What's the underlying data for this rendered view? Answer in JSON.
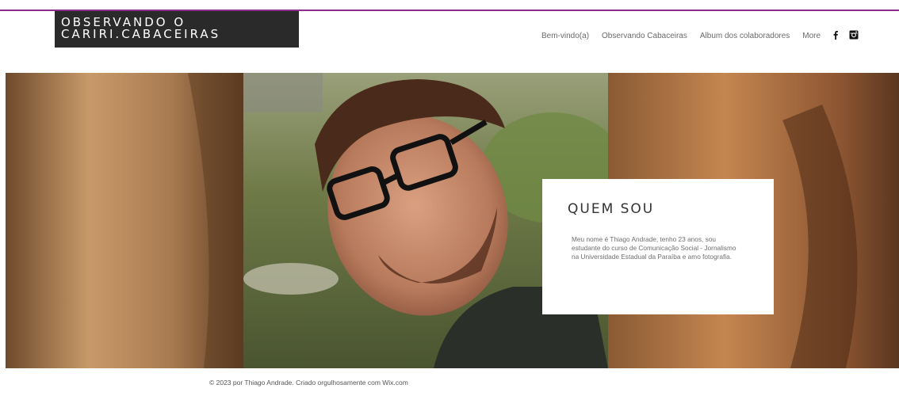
{
  "logo": {
    "line1": "OBSERVANDO O",
    "line2": "CARIRI.CABACEIRAS"
  },
  "nav": {
    "items": [
      {
        "label": "Bem-vindo(a)"
      },
      {
        "label": "Observando Cabaceiras"
      },
      {
        "label": "Album dos colaboradores"
      },
      {
        "label": "More"
      }
    ]
  },
  "social": {
    "icons": [
      "facebook-icon",
      "instagram-icon"
    ]
  },
  "about": {
    "title": "QUEM SOU",
    "text": "Meu nome é Thiago Andrade, tenho 23 anos, sou estudante do curso de Comunicação Social - Jornalismo na Universidade Estadual da Paraíba e amo fotografia."
  },
  "footer": {
    "text": "© 2023 por Thiago Andrade. Criado orgulhosamente com Wix.com"
  },
  "colors": {
    "accent_line": "#8e2b8e",
    "logo_bg": "#2a2a2a",
    "nav_text": "#6b6b6b"
  }
}
